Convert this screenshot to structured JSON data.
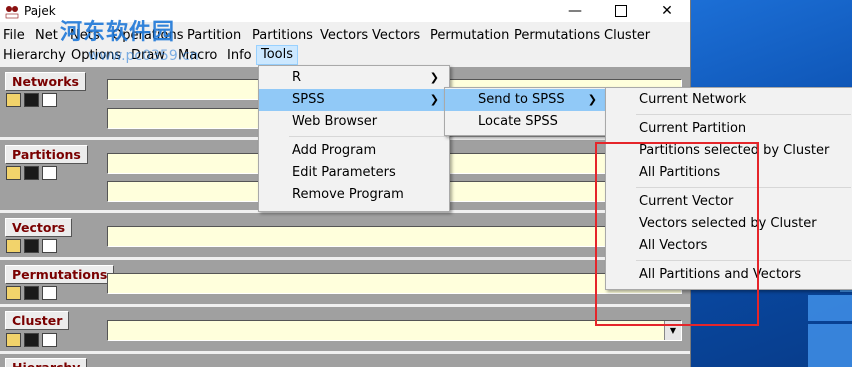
{
  "window": {
    "title": "Pajek",
    "app_icon_text": "PAJEK",
    "controls": {
      "minimize": "—",
      "maximize": "",
      "close": "✕"
    }
  },
  "watermark": {
    "text": "河东软件园",
    "url": "www.pc0359.cn"
  },
  "menu": {
    "row1": [
      "File",
      "Net",
      "Nets",
      "Operations",
      "Partition",
      "Partitions",
      "Vectors",
      "Vectors",
      "Permutation",
      "Permutations",
      "Cluster"
    ],
    "row2": [
      "Hierarchy",
      "Options",
      "Draw",
      "Macro",
      "Info",
      "Tools"
    ]
  },
  "sections": {
    "networks": "Networks",
    "partitions": "Partitions",
    "vectors": "Vectors",
    "permutations": "Permutations",
    "cluster": "Cluster",
    "hierarchy": "Hierarchy"
  },
  "toolbar_icons": [
    "open-icon",
    "save-icon",
    "view-icon"
  ],
  "tools_menu": {
    "items": [
      "R",
      "SPSS",
      "Web Browser",
      "Add Program",
      "Edit Parameters",
      "Remove Program"
    ],
    "highlighted": "SPSS"
  },
  "spss_menu": {
    "items": [
      "Send to SPSS",
      "Locate SPSS"
    ],
    "highlighted": "Send to SPSS"
  },
  "send_menu": {
    "items": [
      "Current Network",
      "Current Partition",
      "Partitions selected by Cluster",
      "All Partitions",
      "Current Vector",
      "Vectors selected by Cluster",
      "All Vectors",
      "All Partitions and Vectors"
    ]
  },
  "colors": {
    "section_label": "#7a0000",
    "field_bg": "#ffffdc",
    "highlight": "#91c9f7",
    "annotation": "#e5252a"
  }
}
